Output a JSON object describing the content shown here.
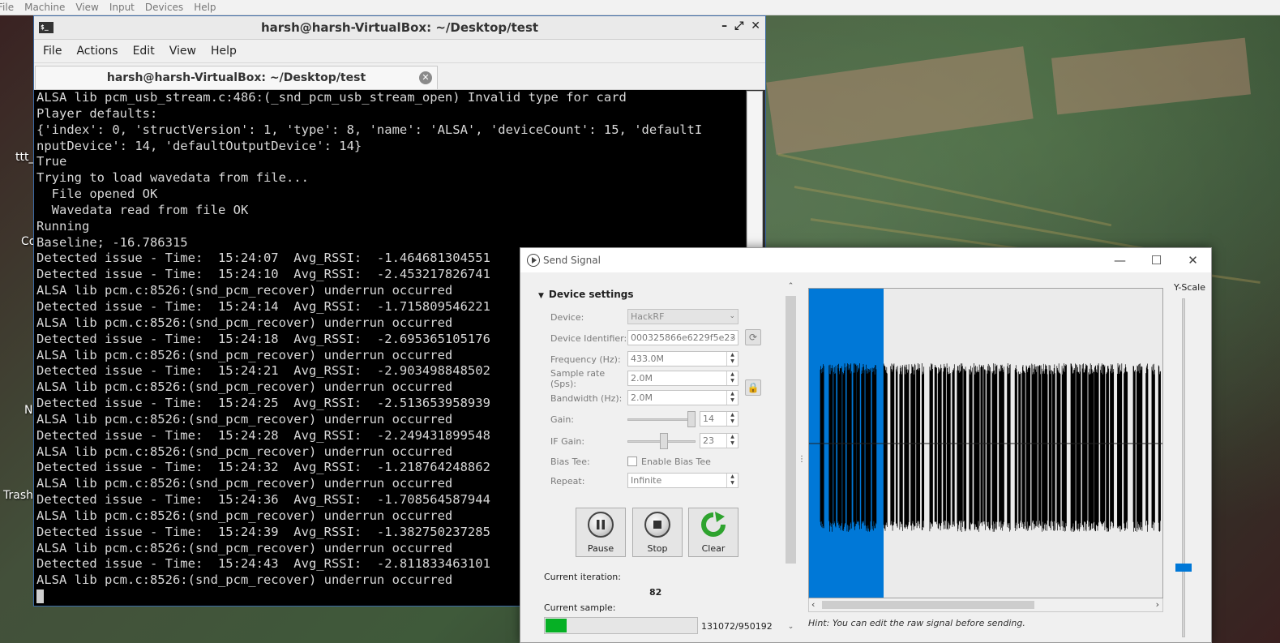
{
  "vbox_menu": [
    "File",
    "Machine",
    "View",
    "Input",
    "Devices",
    "Help"
  ],
  "desktop_labels": [
    "ttt_",
    "Co",
    "N",
    "Trash"
  ],
  "terminal": {
    "title": "harsh@harsh-VirtualBox: ~/Desktop/test",
    "menu": [
      "File",
      "Actions",
      "Edit",
      "View",
      "Help"
    ],
    "tab_label": "harsh@harsh-VirtualBox: ~/Desktop/test",
    "lines": [
      "ALSA lib pcm_usb_stream.c:486:(_snd_pcm_usb_stream_open) Invalid type for card",
      "Player defaults:",
      "{'index': 0, 'structVersion': 1, 'type': 8, 'name': 'ALSA', 'deviceCount': 15, 'defaultI",
      "nputDevice': 14, 'defaultOutputDevice': 14}",
      "True",
      "Trying to load wavedata from file...",
      "  File opened OK",
      "  Wavedata read from file OK",
      "Running",
      "Baseline; -16.786315",
      "Detected issue - Time:  15:24:07  Avg_RSSI:  -1.464681304551",
      "Detected issue - Time:  15:24:10  Avg_RSSI:  -2.453217826741",
      "ALSA lib pcm.c:8526:(snd_pcm_recover) underrun occurred",
      "Detected issue - Time:  15:24:14  Avg_RSSI:  -1.715809546221",
      "ALSA lib pcm.c:8526:(snd_pcm_recover) underrun occurred",
      "Detected issue - Time:  15:24:18  Avg_RSSI:  -2.695365105176",
      "ALSA lib pcm.c:8526:(snd_pcm_recover) underrun occurred",
      "Detected issue - Time:  15:24:21  Avg_RSSI:  -2.903498848502",
      "ALSA lib pcm.c:8526:(snd_pcm_recover) underrun occurred",
      "Detected issue - Time:  15:24:25  Avg_RSSI:  -2.513653958939",
      "ALSA lib pcm.c:8526:(snd_pcm_recover) underrun occurred",
      "Detected issue - Time:  15:24:28  Avg_RSSI:  -2.249431899548",
      "ALSA lib pcm.c:8526:(snd_pcm_recover) underrun occurred",
      "Detected issue - Time:  15:24:32  Avg_RSSI:  -1.218764248862",
      "ALSA lib pcm.c:8526:(snd_pcm_recover) underrun occurred",
      "Detected issue - Time:  15:24:36  Avg_RSSI:  -1.708564587944",
      "ALSA lib pcm.c:8526:(snd_pcm_recover) underrun occurred",
      "Detected issue - Time:  15:24:39  Avg_RSSI:  -1.382750237285",
      "ALSA lib pcm.c:8526:(snd_pcm_recover) underrun occurred",
      "Detected issue - Time:  15:24:43  Avg_RSSI:  -2.811833463101",
      "ALSA lib pcm.c:8526:(snd_pcm_recover) underrun occurred"
    ]
  },
  "send_signal": {
    "title": "Send Signal",
    "section_title": "Device settings",
    "device": {
      "label": "Device:",
      "value": "HackRF"
    },
    "device_identifier": {
      "label": "Device Identifier:",
      "value": "000325866e6229f5e23"
    },
    "frequency": {
      "label": "Frequency (Hz):",
      "value": "433.0M"
    },
    "sample_rate": {
      "label": "Sample rate (Sps):",
      "value": "2.0M"
    },
    "bandwidth": {
      "label": "Bandwidth (Hz):",
      "value": "2.0M"
    },
    "gain": {
      "label": "Gain:",
      "value": "14",
      "slider_fraction": 0.92
    },
    "if_gain": {
      "label": "IF Gain:",
      "value": "23",
      "slider_fraction": 0.5
    },
    "bias_tee": {
      "label": "Bias Tee:",
      "checkbox_label": "Enable Bias Tee",
      "checked": false
    },
    "repeat": {
      "label": "Repeat:",
      "value": "Infinite"
    },
    "buttons": {
      "pause": "Pause",
      "stop": "Stop",
      "clear": "Clear"
    },
    "current_iteration_label": "Current iteration:",
    "current_iteration_value": "82",
    "current_sample_label": "Current sample:",
    "current_sample_text": "131072/950192",
    "current_sample_fraction": 0.138,
    "yscale_label": "Y-Scale",
    "hint": "Hint: You can edit the raw signal before sending.",
    "selection_fraction": 0.21,
    "colors": {
      "selection": "#0078d7",
      "progress": "#06b025",
      "signal": "#000000"
    }
  }
}
